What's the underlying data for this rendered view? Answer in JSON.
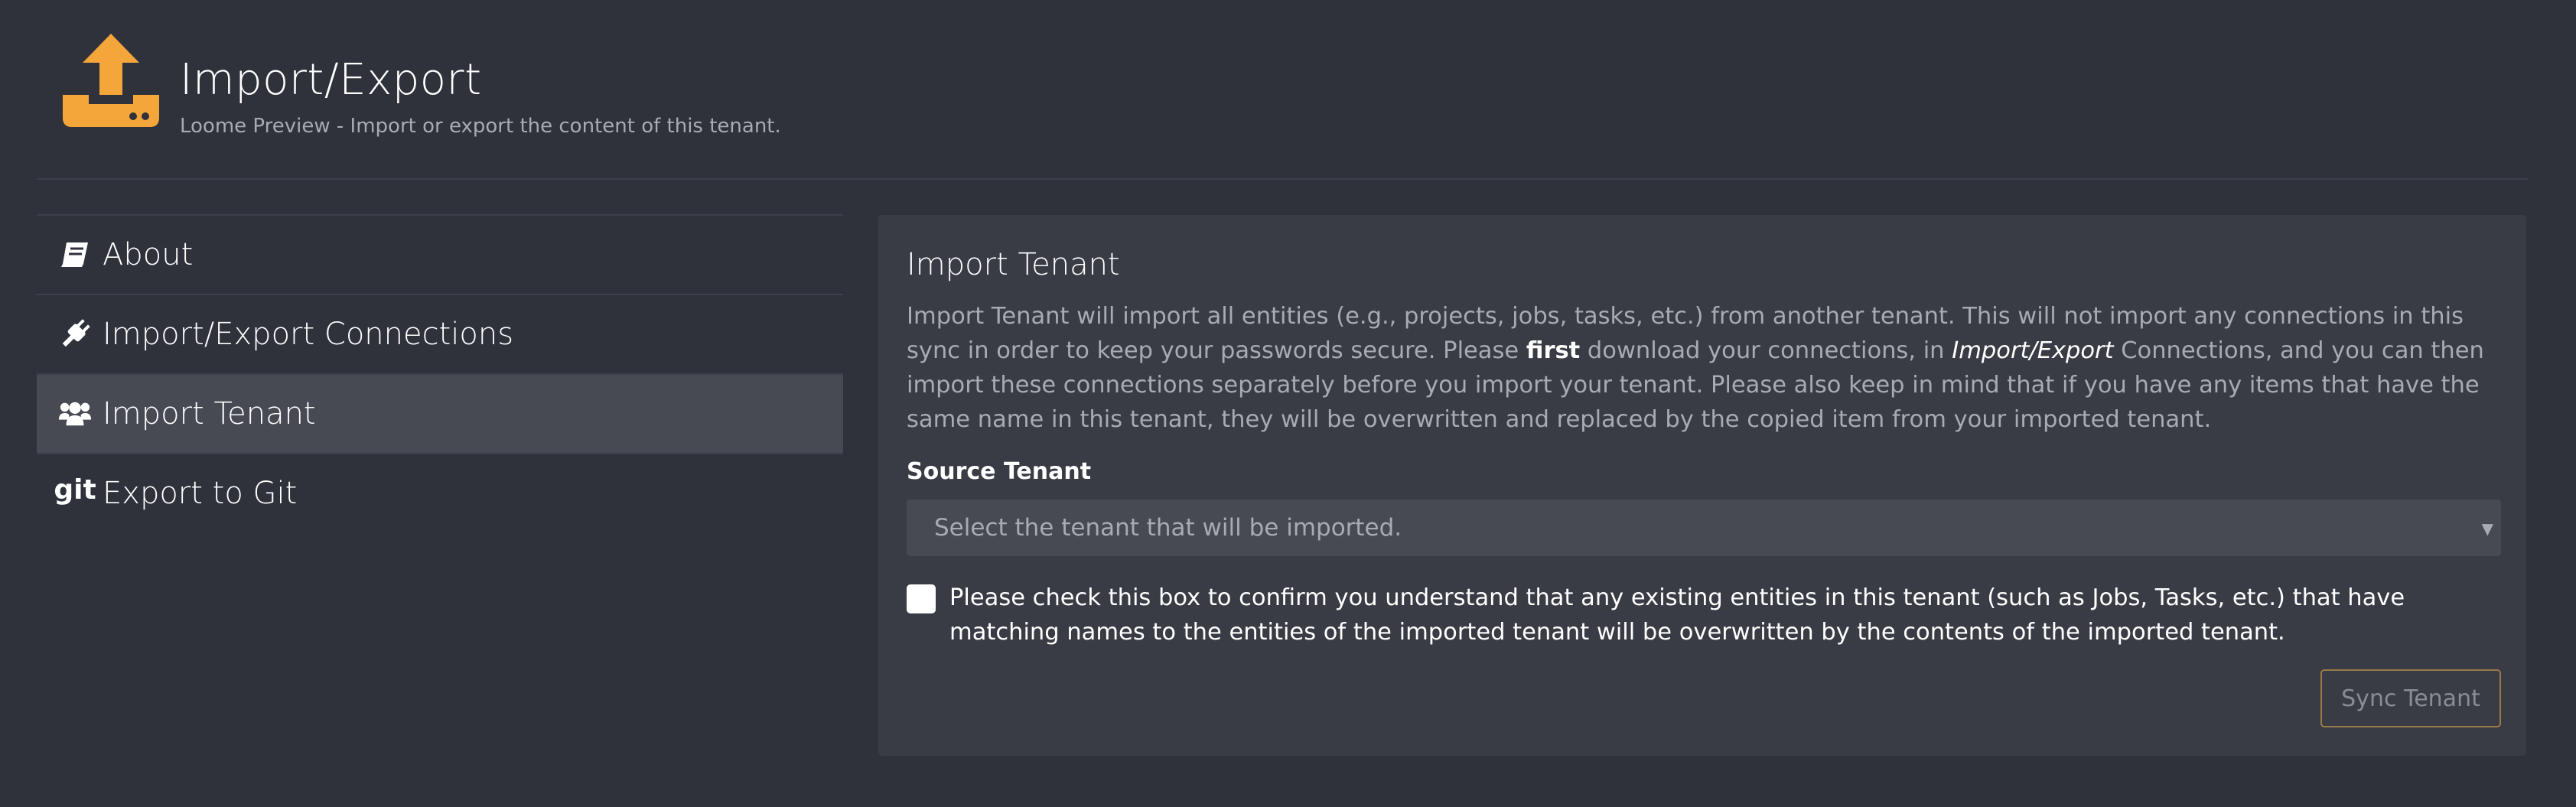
{
  "header": {
    "title": "Import/Export",
    "subtitle": "Loome Preview - Import or export the content of this tenant.",
    "icon": "upload-tray-icon",
    "accent_color": "#f5a63b"
  },
  "sidebar": {
    "items": [
      {
        "label": "About",
        "icon": "book-icon",
        "active": false
      },
      {
        "label": "Import/Export Connections",
        "icon": "plug-icon",
        "active": false
      },
      {
        "label": "Import Tenant",
        "icon": "users-icon",
        "active": true
      },
      {
        "label": "Export to Git",
        "icon": "git-icon",
        "active": false
      }
    ],
    "git_glyph": "git"
  },
  "panel": {
    "title": "Import Tenant",
    "description": {
      "part1": "Import Tenant will import all entities (e.g., projects, jobs, tasks, etc.) from another tenant. This will not import any connections in this sync in order to keep your passwords secure. Please ",
      "bold": "first",
      "part2": " download your connections, in ",
      "italic": "Import/Export",
      "part3": " Connections, and you can then import these connections separately before you import your tenant. Please also keep in mind that if you have any items that have the same name in this tenant, they will be overwritten and replaced by the copied item from your imported tenant."
    },
    "source_label": "Source Tenant",
    "source_placeholder": "Select the tenant that will be imported.",
    "confirm_text": "Please check this box to confirm you understand that any existing entities in this tenant (such as Jobs, Tasks, etc.) that have matching names to the entities of the imported tenant will be overwritten by the contents of the imported tenant.",
    "sync_button_label": "Sync Tenant"
  }
}
